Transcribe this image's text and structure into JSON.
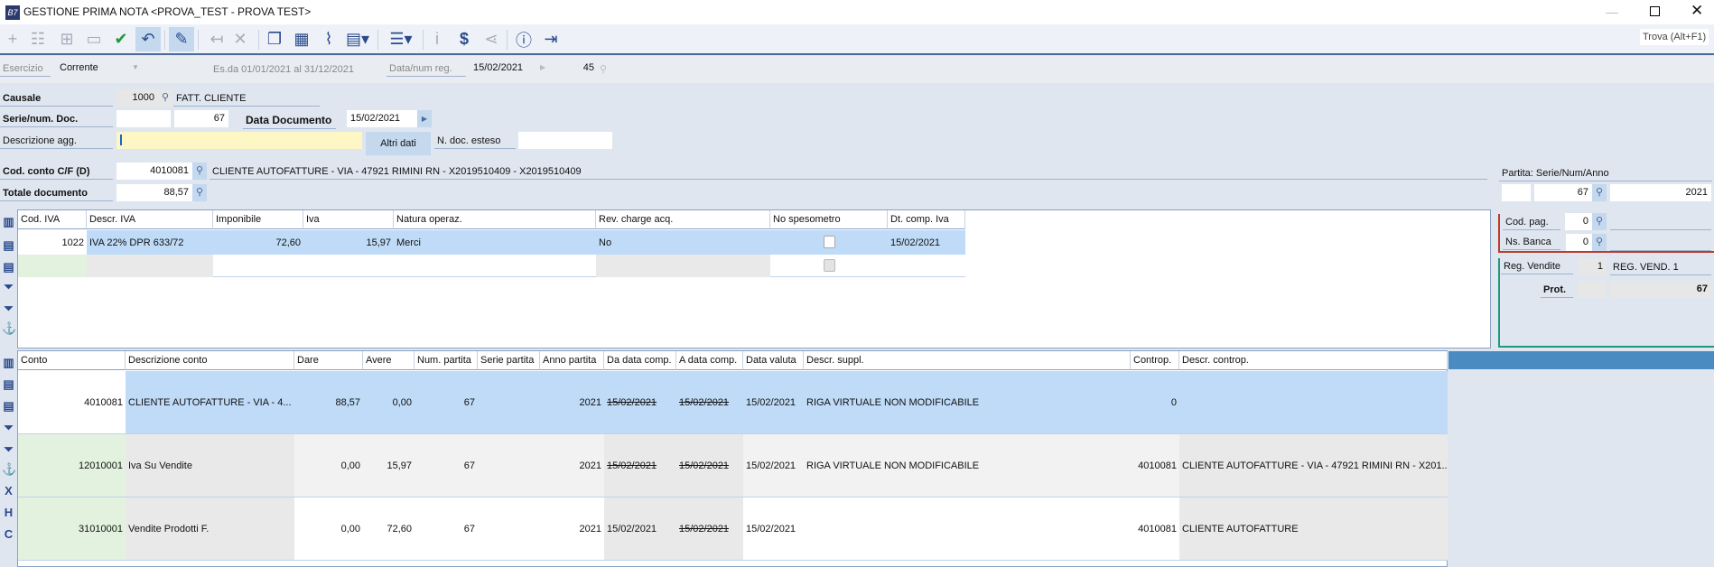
{
  "window": {
    "title": "GESTIONE PRIMA NOTA <PROVA_TEST - PROVA TEST>",
    "logo": "B7"
  },
  "toolbar": {
    "find_label": "Trova (Alt+F1)"
  },
  "period": {
    "esercizio_label": "Esercizio",
    "esercizio_value": "Corrente",
    "range": "Es.da 01/01/2021 al 31/12/2021",
    "data_num_label": "Data/num reg.",
    "data_reg": "15/02/2021",
    "num_reg": "45"
  },
  "form": {
    "causale_label": "Causale",
    "causale_code": "1000",
    "causale_desc": "FATT. CLIENTE",
    "serie_label": "Serie/num. Doc.",
    "serie_value": "",
    "num_doc": "67",
    "data_doc_label": "Data Documento",
    "data_doc": "15/02/2021",
    "descr_label": "Descrizione agg.",
    "descr_value": "",
    "altri_dati": "Altri dati",
    "ndoc_label": "N. doc. esteso",
    "ndoc_value": "",
    "conto_label": "Cod. conto C/F  (D)",
    "conto_code": "4010081",
    "conto_desc": "CLIENTE AUTOFATTURE  - VIA - 47921 RIMINI RN - X2019510409 - X2019510409",
    "totale_label": "Totale documento",
    "totale_value": "88,57"
  },
  "partita": {
    "label": "Partita: Serie/Num/Anno",
    "serie": "",
    "num": "67",
    "anno": "2021"
  },
  "payment": {
    "cod_pag_label": "Cod. pag.",
    "cod_pag": "0",
    "ns_banca_label": "Ns. Banca",
    "ns_banca": "0"
  },
  "registro": {
    "label": "Reg. Vendite",
    "num": "1",
    "desc": "REG. VEND. 1",
    "prot_label": "Prot.",
    "prot": "67"
  },
  "iva_grid": {
    "headers": [
      "Cod. IVA",
      "Descr. IVA",
      "Imponibile",
      "Iva",
      "Natura operaz.",
      "Rev. charge acq.",
      "No spesometro",
      "Dt. comp. Iva"
    ],
    "rows": [
      {
        "cod": "1022",
        "descr": "IVA 22% DPR 633/72",
        "imponibile": "72,60",
        "iva": "15,97",
        "natura": "Merci",
        "rev": "No",
        "dt": "15/02/2021"
      }
    ]
  },
  "journal": {
    "headers": [
      "Conto",
      "Descrizione conto",
      "Dare",
      "Avere",
      "Num. partita",
      "Serie partita",
      "Anno partita",
      "Da data comp.",
      "A data comp.",
      "Data valuta",
      "Descr. suppl.",
      "Controp.",
      "Descr. controp."
    ],
    "rows": [
      {
        "conto": "4010081",
        "descr": "CLIENTE AUTOFATTURE  - VIA - 4...",
        "dare": "88,57",
        "avere": "0,00",
        "num": "67",
        "serie": "",
        "anno": "2021",
        "da": "15/02/2021",
        "a": "15/02/2021",
        "valuta": "15/02/2021",
        "suppl": "RIGA VIRTUALE NON MODIFICABILE",
        "controp": "0",
        "dcontrop": ""
      },
      {
        "conto": "12010001",
        "descr": "Iva Su Vendite",
        "dare": "0,00",
        "avere": "15,97",
        "num": "67",
        "serie": "",
        "anno": "2021",
        "da": "15/02/2021",
        "a": "15/02/2021",
        "valuta": "15/02/2021",
        "suppl": "RIGA VIRTUALE NON MODIFICABILE",
        "controp": "4010081",
        "dcontrop": "CLIENTE AUTOFATTURE  - VIA - 47921 RIMINI RN - X201..."
      },
      {
        "conto": "31010001",
        "descr": "Vendite Prodotti F.",
        "dare": "0,00",
        "avere": "72,60",
        "num": "67",
        "serie": "",
        "anno": "2021",
        "da": "15/02/2021",
        "a": "15/02/2021",
        "valuta": "15/02/2021",
        "suppl": "",
        "controp": "4010081",
        "dcontrop": "CLIENTE AUTOFATTURE"
      }
    ]
  }
}
